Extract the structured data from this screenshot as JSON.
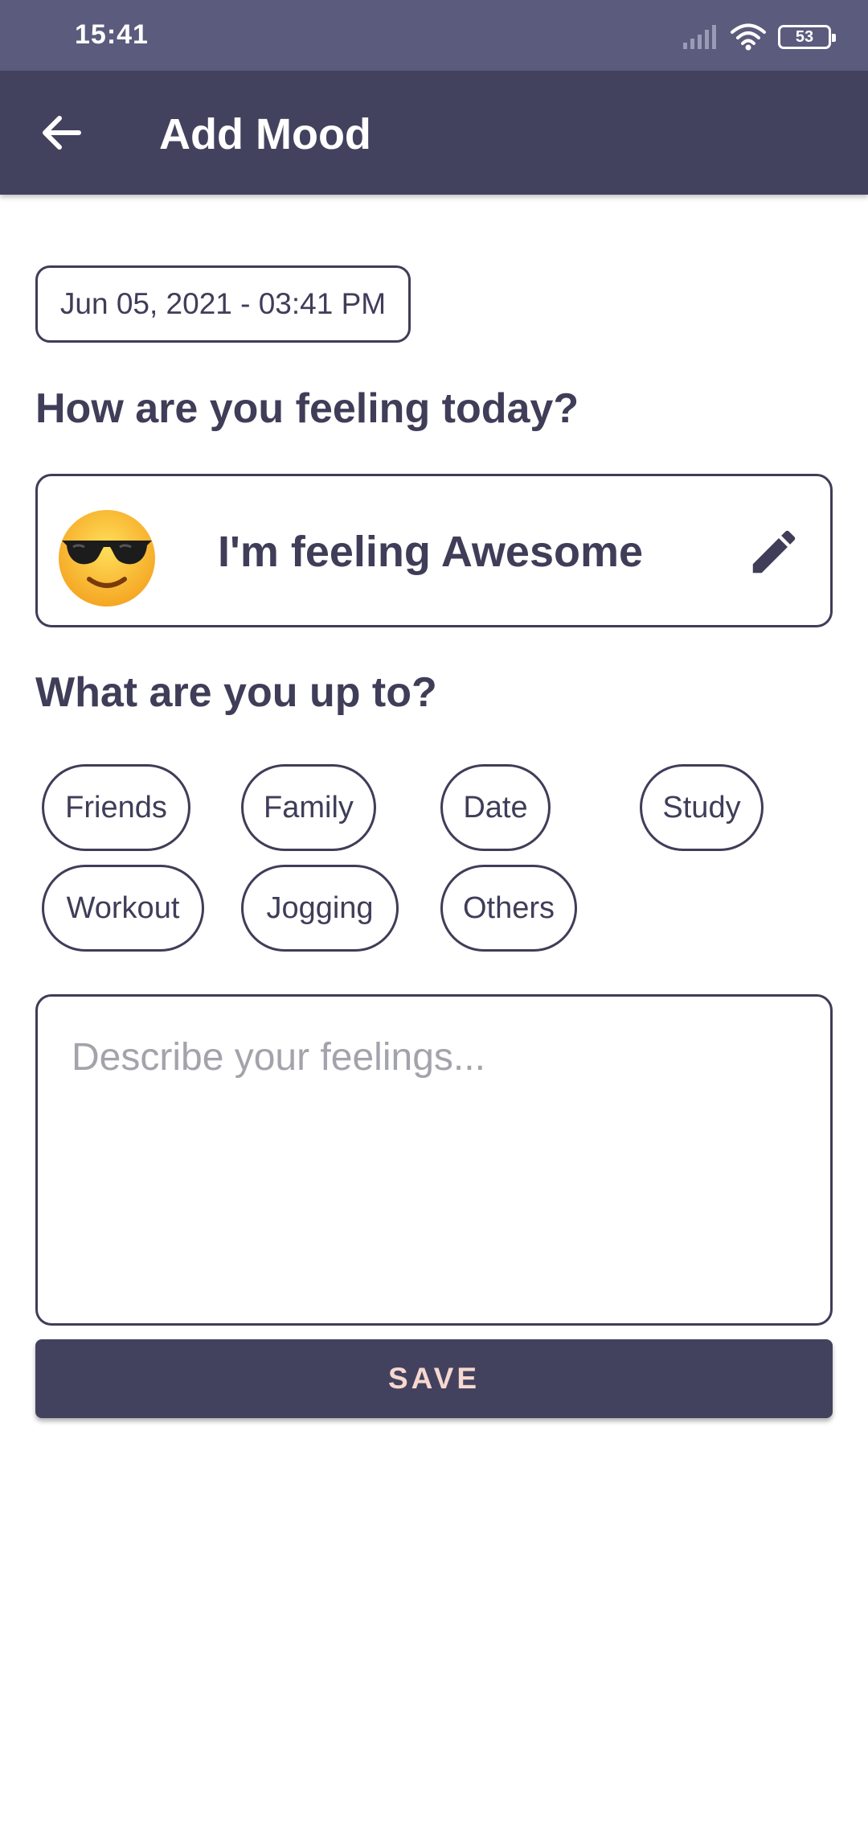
{
  "status_bar": {
    "time": "15:41",
    "battery_level": "53",
    "icons": [
      "signal-icon",
      "wifi-icon",
      "battery-icon"
    ]
  },
  "app_bar": {
    "title": "Add Mood",
    "back_icon": "arrow-left-icon"
  },
  "date_chip": {
    "label": "Jun 05, 2021 - 03:41 PM"
  },
  "mood_section": {
    "heading": "How are you feeling today?",
    "mood_text": "I'm feeling Awesome",
    "emoji_icon": "smiling-face-with-sunglasses-icon",
    "edit_icon": "pencil-icon"
  },
  "activity_section": {
    "heading": "What are you up to?",
    "activities": [
      "Friends",
      "Family",
      "Date",
      "Study",
      "Workout",
      "Jogging",
      "Others"
    ]
  },
  "feelings_input": {
    "placeholder": "Describe your feelings...",
    "value": ""
  },
  "save_button": {
    "label": "SAVE"
  },
  "colors": {
    "primary": "#43425e",
    "status_bar": "#5b5b7e",
    "text": "#3f3d58",
    "save_label": "#f6d8d0",
    "placeholder": "#a3a3ab"
  }
}
